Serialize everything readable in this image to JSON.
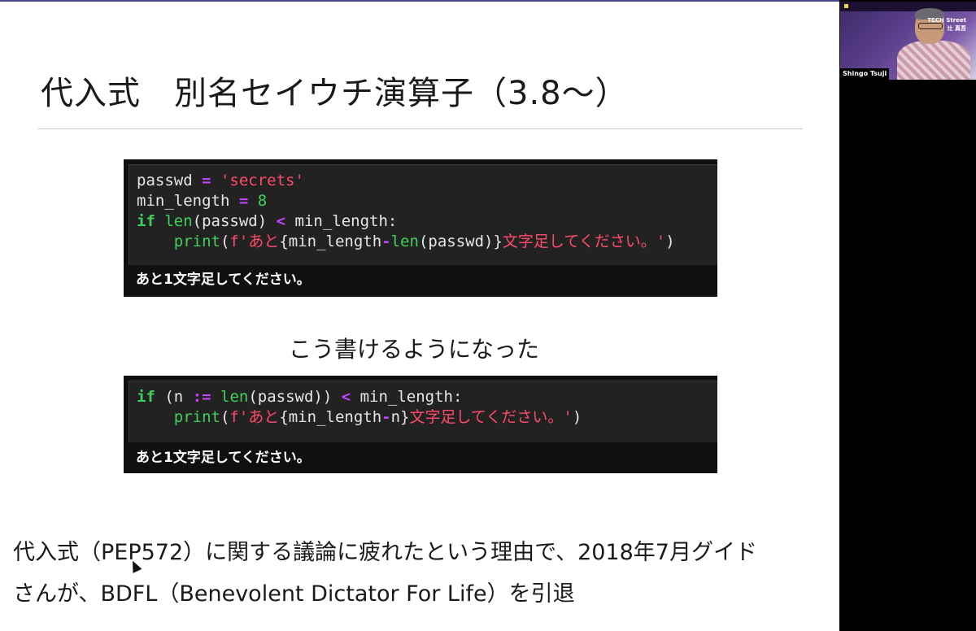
{
  "slide": {
    "title": "代入式　別名セイウチ演算子（3.8〜）",
    "code_block_1": {
      "lines": [
        [
          {
            "t": "passwd ",
            "c": "pl"
          },
          {
            "t": "=",
            "c": "op"
          },
          {
            "t": " ",
            "c": "pl"
          },
          {
            "t": "'secrets'",
            "c": "str"
          }
        ],
        [
          {
            "t": "min_length ",
            "c": "pl"
          },
          {
            "t": "=",
            "c": "op"
          },
          {
            "t": " ",
            "c": "pl"
          },
          {
            "t": "8",
            "c": "num"
          }
        ],
        [
          {
            "t": "if",
            "c": "kw"
          },
          {
            "t": " ",
            "c": "pl"
          },
          {
            "t": "len",
            "c": "fn"
          },
          {
            "t": "(passwd) ",
            "c": "pl"
          },
          {
            "t": "<",
            "c": "op"
          },
          {
            "t": " min_length:",
            "c": "pl"
          }
        ],
        [
          {
            "t": "    ",
            "c": "pl"
          },
          {
            "t": "print",
            "c": "fn"
          },
          {
            "t": "(",
            "c": "pl"
          },
          {
            "t": "f'あと",
            "c": "str"
          },
          {
            "t": "{min_length",
            "c": "pl"
          },
          {
            "t": "-",
            "c": "op"
          },
          {
            "t": "len",
            "c": "fn"
          },
          {
            "t": "(passwd)}",
            "c": "pl"
          },
          {
            "t": "文字足してください。'",
            "c": "str"
          },
          {
            "t": ")",
            "c": "pl"
          }
        ]
      ],
      "output": "あと1文字足してください。"
    },
    "caption": "こう書けるようになった",
    "code_block_2": {
      "lines": [
        [
          {
            "t": "if",
            "c": "kw"
          },
          {
            "t": " (n ",
            "c": "pl"
          },
          {
            "t": ":=",
            "c": "op"
          },
          {
            "t": " ",
            "c": "pl"
          },
          {
            "t": "len",
            "c": "fn"
          },
          {
            "t": "(passwd)) ",
            "c": "pl"
          },
          {
            "t": "<",
            "c": "op"
          },
          {
            "t": " min_length:",
            "c": "pl"
          }
        ],
        [
          {
            "t": "    ",
            "c": "pl"
          },
          {
            "t": "print",
            "c": "fn"
          },
          {
            "t": "(",
            "c": "pl"
          },
          {
            "t": "f'あと",
            "c": "str"
          },
          {
            "t": "{min_length",
            "c": "pl"
          },
          {
            "t": "-",
            "c": "op"
          },
          {
            "t": "n}",
            "c": "pl"
          },
          {
            "t": "文字足してください。'",
            "c": "str"
          },
          {
            "t": ")",
            "c": "pl"
          }
        ]
      ],
      "output": "あと1文字足してください。"
    },
    "paragraph_line_1": "代入式（PEP572）に関する議論に疲れたという理由で、2018年7月グイド",
    "paragraph_line_2": "さんが、BDFL（Benevolent Dictator For Life）を引退"
  },
  "video": {
    "brand_line_1": "TECH Street",
    "brand_line_2": "辻 真吾",
    "speaker_name": "Shingo Tsuji"
  },
  "colors": {
    "keyword": "#3fd25b",
    "operator": "#c044ff",
    "string": "#ff4a6a",
    "code_bg": "#222222",
    "panel_bg": "#101010"
  }
}
